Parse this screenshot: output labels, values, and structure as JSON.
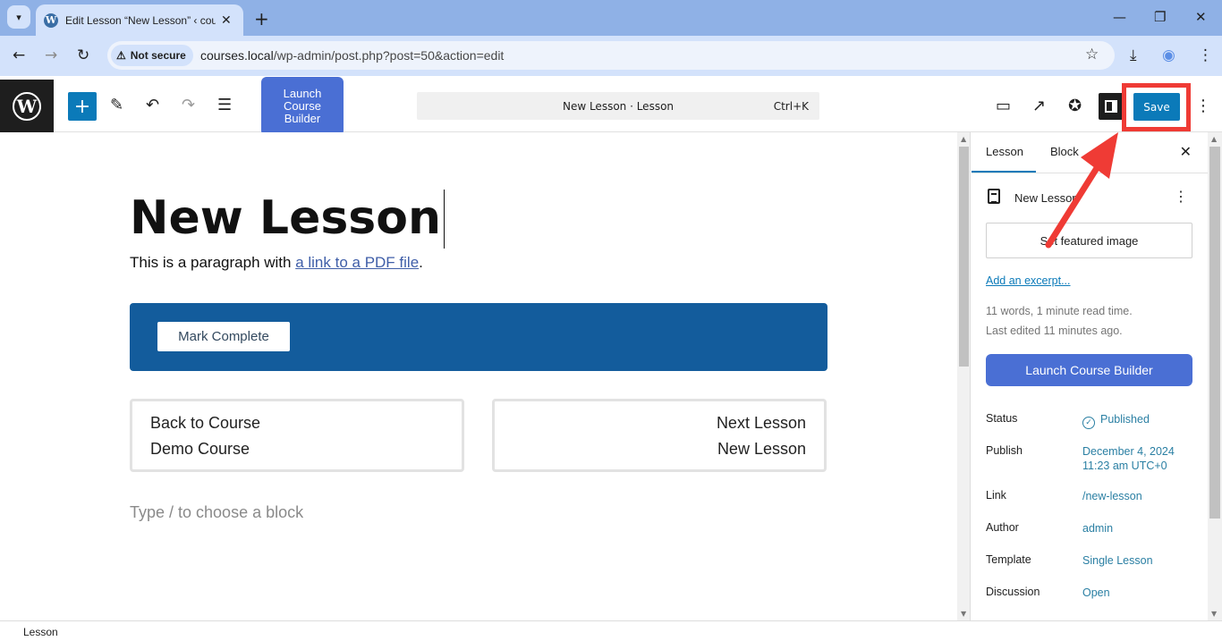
{
  "browser": {
    "tab_title": "Edit Lesson “New Lesson” ‹ cou",
    "security_label": "Not secure",
    "url_host": "courses.local",
    "url_path": "/wp-admin/post.php?post=50&action=edit"
  },
  "toolbar": {
    "launch_builder_label": "Launch Course Builder",
    "command_bar_title": "New Lesson · Lesson",
    "command_bar_shortcut": "Ctrl+K",
    "save_label": "Save"
  },
  "editor": {
    "title": "New Lesson",
    "paragraph_text": "This is a paragraph with ",
    "paragraph_link": "a link to a PDF file",
    "paragraph_end": ".",
    "mark_complete_label": "Mark Complete",
    "prev_card": {
      "line1": "Back to Course",
      "line2": "Demo Course"
    },
    "next_card": {
      "line1": "Next Lesson",
      "line2": "New Lesson"
    },
    "block_placeholder": "Type / to choose a block"
  },
  "sidebar": {
    "tabs": [
      {
        "label": "Lesson",
        "active": true
      },
      {
        "label": "Block",
        "active": false
      }
    ],
    "post_title": "New Lesson",
    "featured_image_label": "Set featured image",
    "excerpt_link": "Add an excerpt...",
    "stats_words": "11 words, 1 minute read time.",
    "stats_edited": "Last edited 11 minutes ago.",
    "launch_builder_label": "Launch Course Builder",
    "rows": [
      {
        "label": "Status",
        "value": "Published"
      },
      {
        "label": "Publish",
        "value": "December 4, 2024",
        "value2": "11:23 am UTC+0"
      },
      {
        "label": "Link",
        "value": "/new-lesson"
      },
      {
        "label": "Author",
        "value": "admin"
      },
      {
        "label": "Template",
        "value": "Single Lesson"
      },
      {
        "label": "Discussion",
        "value": "Open"
      }
    ]
  },
  "footer": {
    "breadcrumb": "Lesson"
  },
  "colors": {
    "accent": "#0b7ab9",
    "builder_button": "#4a6fd4",
    "mark_block": "#135c9c",
    "annotation": "#ef3b35"
  }
}
